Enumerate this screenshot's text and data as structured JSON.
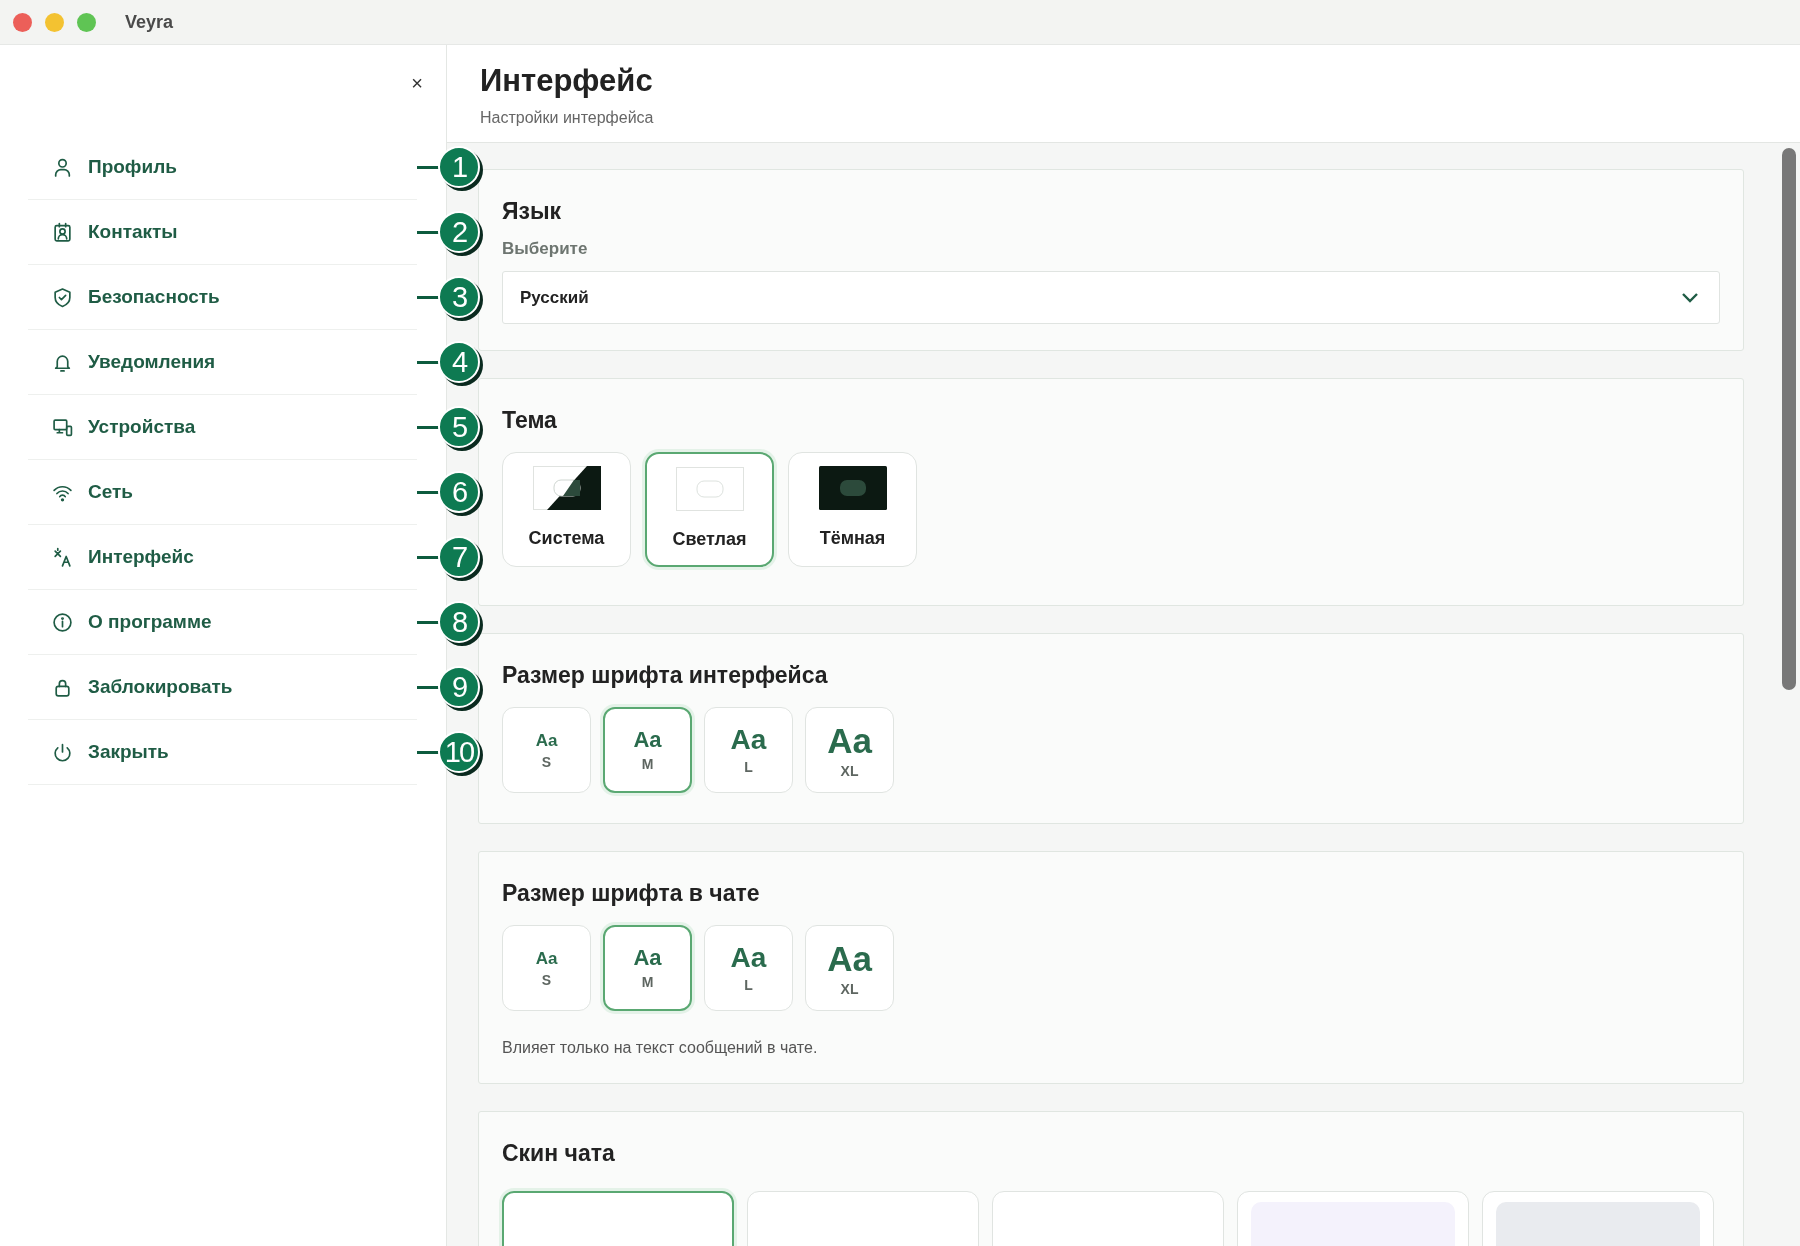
{
  "window": {
    "title": "Veyra"
  },
  "sidebar": {
    "close": "×",
    "items": [
      {
        "label": "Профиль",
        "callout": "1"
      },
      {
        "label": "Контакты",
        "callout": "2"
      },
      {
        "label": "Безопасность",
        "callout": "3"
      },
      {
        "label": "Уведомления",
        "callout": "4"
      },
      {
        "label": "Устройства",
        "callout": "5"
      },
      {
        "label": "Сеть",
        "callout": "6"
      },
      {
        "label": "Интерфейс",
        "callout": "7"
      },
      {
        "label": "О программе",
        "callout": "8"
      },
      {
        "label": "Заблокировать",
        "callout": "9"
      },
      {
        "label": "Закрыть",
        "callout": "10"
      }
    ]
  },
  "header": {
    "title": "Интерфейс",
    "subtitle": "Настройки интерфейса"
  },
  "sections": [
    {
      "kind": "select",
      "title": "Язык",
      "label": "Выберите",
      "value": "Русский"
    },
    {
      "kind": "theme",
      "title": "Тема",
      "options": [
        {
          "kind": "system",
          "label": "Система",
          "selected": false
        },
        {
          "kind": "light",
          "label": "Светлая",
          "selected": true
        },
        {
          "kind": "dark",
          "label": "Тёмная",
          "selected": false
        }
      ]
    },
    {
      "kind": "size",
      "title": "Размер шрифта интерфейса",
      "options": [
        {
          "sample": "Aa",
          "label": "S",
          "selected": false
        },
        {
          "sample": "Aa",
          "label": "M",
          "selected": true
        },
        {
          "sample": "Aa",
          "label": "L",
          "selected": false
        },
        {
          "sample": "Aa",
          "label": "XL",
          "selected": false
        }
      ]
    },
    {
      "kind": "size",
      "title": "Размер шрифта в чате",
      "note": "Влияет только на текст сообщений в чате.",
      "options": [
        {
          "sample": "Aa",
          "label": "S",
          "selected": false
        },
        {
          "sample": "Aa",
          "label": "M",
          "selected": true
        },
        {
          "sample": "Aa",
          "label": "L",
          "selected": false
        },
        {
          "sample": "Aa",
          "label": "XL",
          "selected": false
        }
      ]
    },
    {
      "kind": "skin",
      "title": "Скин чата",
      "options": [
        {
          "selected": true
        },
        {
          "selected": false
        },
        {
          "selected": false
        },
        {
          "color": "#f4f2fc",
          "selected": false
        },
        {
          "color": "#e9ebef",
          "selected": false
        }
      ]
    }
  ]
}
